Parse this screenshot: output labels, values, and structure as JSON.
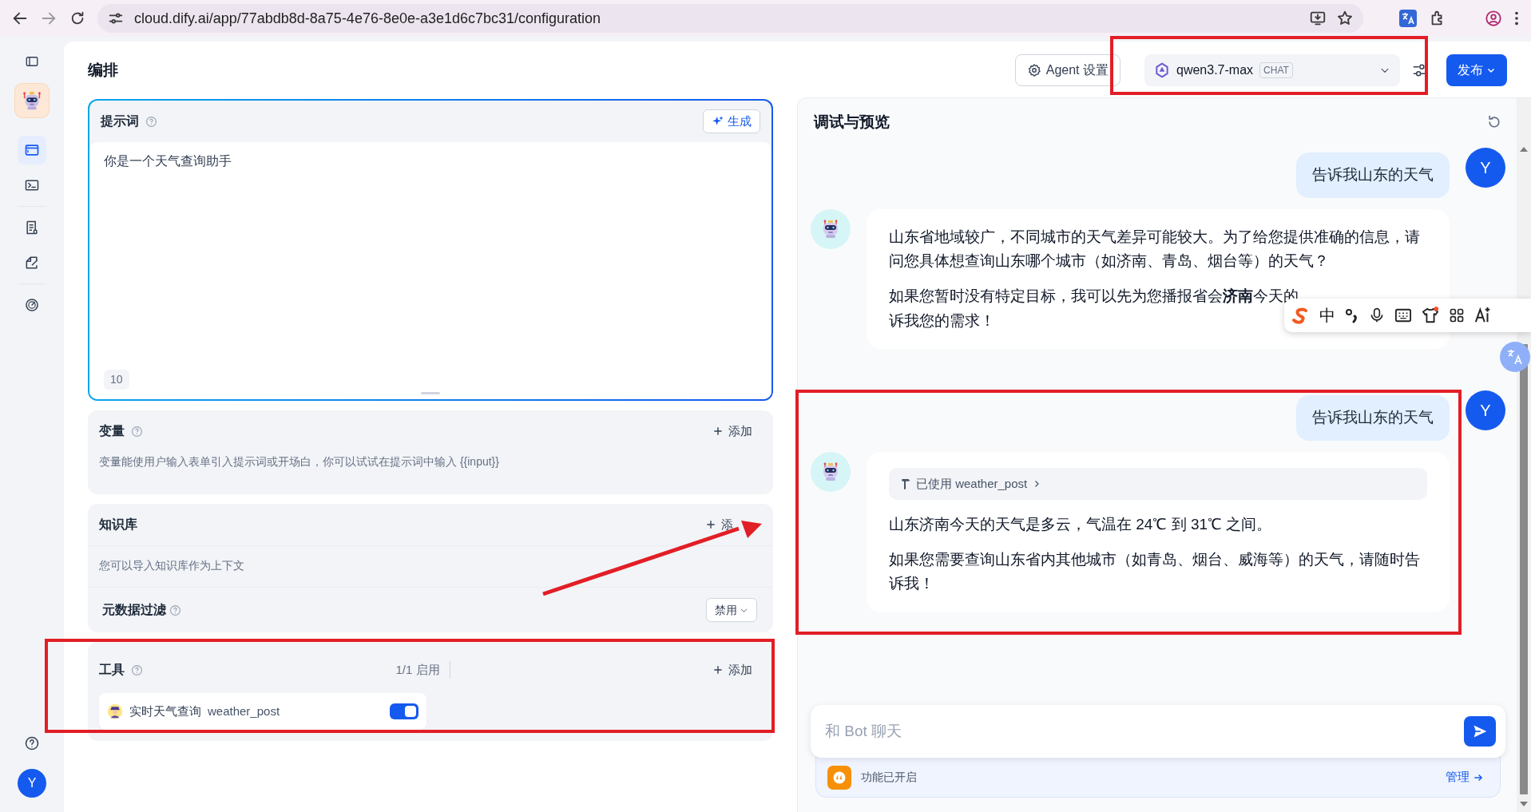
{
  "browser": {
    "url": "cloud.dify.ai/app/77abdb8d-8a75-4e76-8e0e-a3e1d6c7bc31/configuration"
  },
  "sidebar": {
    "items": [
      {
        "kind": "orchestrate",
        "selected": true
      },
      {
        "kind": "api",
        "selected": false
      },
      {
        "kind": "logs",
        "selected": false
      },
      {
        "kind": "annotation",
        "selected": false
      },
      {
        "kind": "monitor",
        "selected": false
      }
    ],
    "user_avatar": "Y"
  },
  "header": {
    "title": "编排",
    "agent_button": "Agent 设置",
    "model": {
      "name": "qwen3.7-max",
      "mode": "CHAT"
    },
    "publish": "发布"
  },
  "prompt": {
    "title": "提示词",
    "generate": "生成",
    "text": "你是一个天气查询助手",
    "count": "10"
  },
  "variables": {
    "title": "变量",
    "add": "添加",
    "hint": "变量能使用户输入表单引入提示词或开场白，你可以试试在提示词中输入 {{input}}"
  },
  "knowledge": {
    "title": "知识库",
    "add": "添",
    "hint": "您可以导入知识库作为上下文",
    "metadata_filter": {
      "label": "元数据过滤",
      "value": "禁用"
    }
  },
  "tools": {
    "title": "工具",
    "count": "1/1 启用",
    "add": "添加",
    "items": [
      {
        "name": "实时天气查询",
        "id": "weather_post",
        "on": true
      }
    ]
  },
  "debug": {
    "title": "调试与预览",
    "messages": [
      {
        "kind": "user",
        "text": "告诉我山东的天气",
        "avatar": "Y"
      },
      {
        "kind": "bot",
        "paragraphs": [
          [
            "山东省地域较广，不同城市的天气差异可能较大。为了给您提供准确的信息，请问您具体想查询山东哪个城市（如济南、青岛、烟台等）的天气？"
          ],
          [
            "如果您暂时没有特定目标，我可以先为您播报省会**济南**今天的",
            "诉我您的需求！"
          ]
        ]
      },
      {
        "kind": "user",
        "text": "告诉我山东的天气",
        "avatar": "Y"
      },
      {
        "kind": "bot",
        "tool_call": {
          "label": "已使用 weather_post"
        },
        "paragraphs": [
          [
            "山东济南今天的天气是多云，气温在 24℃ 到 31℃ 之间。"
          ],
          [
            "如果您需要查询山东省内其他城市（如青岛、烟台、威海等）的天气，请随时告诉我！"
          ]
        ]
      }
    ],
    "input": {
      "placeholder": "和 Bot 聊天"
    },
    "features": {
      "label": "功能已开启",
      "manage": "管理"
    }
  },
  "ime_toolbar": {
    "mode": "中"
  }
}
